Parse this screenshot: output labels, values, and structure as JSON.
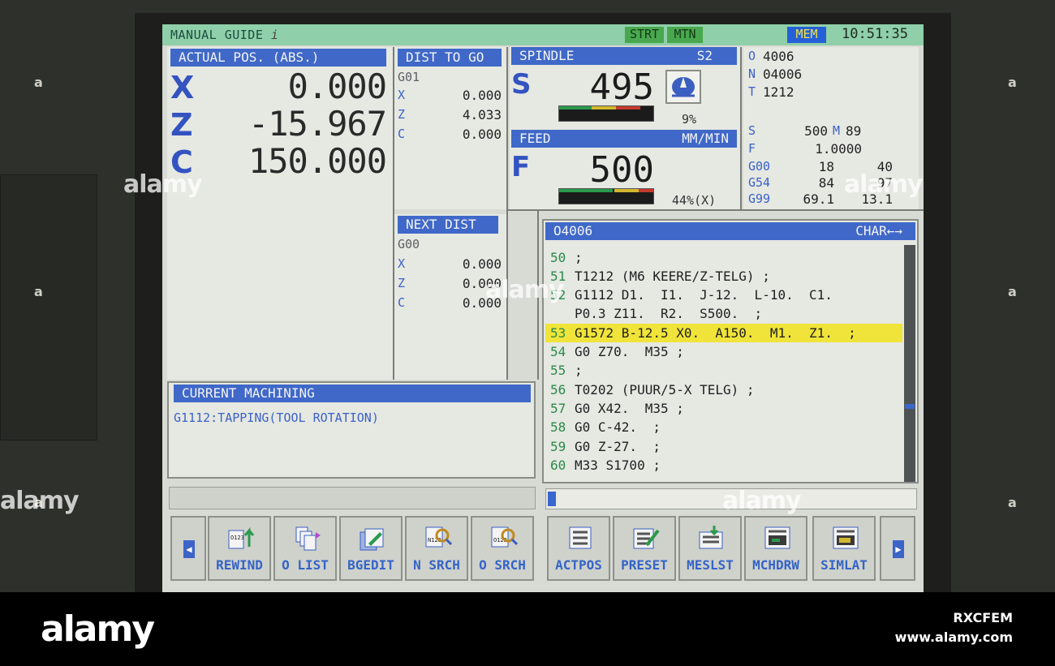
{
  "status": {
    "mode": "MANUAL GUIDE",
    "mode_suffix": "i",
    "strt": "STRT",
    "mtn": "MTN",
    "mem": "MEM",
    "clock": "10:51:35"
  },
  "actual_pos": {
    "title": "ACTUAL POS. (ABS.)",
    "axes": [
      {
        "axis": "X",
        "value": "0.000"
      },
      {
        "axis": "Z",
        "value": "-15.967"
      },
      {
        "axis": "C",
        "value": "150.000"
      }
    ]
  },
  "dist_to_go": {
    "title": "DIST TO GO",
    "gcode": "G01",
    "rows": [
      {
        "axis": "X",
        "value": "0.000"
      },
      {
        "axis": "Z",
        "value": "4.033"
      },
      {
        "axis": "C",
        "value": "0.000"
      }
    ]
  },
  "next_dist": {
    "title": "NEXT DIST",
    "gcode": "G00",
    "rows": [
      {
        "axis": "X",
        "value": "0.000"
      },
      {
        "axis": "Z",
        "value": "0.000"
      },
      {
        "axis": "C",
        "value": "0.000"
      }
    ]
  },
  "spindle": {
    "title": "SPINDLE",
    "id": "S2",
    "letter": "S",
    "value": "495",
    "load": "9%",
    "load_fraction": 0.09
  },
  "feed": {
    "title": "FEED",
    "unit": "MM/MIN",
    "letter": "F",
    "value": "500",
    "override": "44%(X)",
    "override_fraction": 0.44
  },
  "modal": {
    "o_label": "O",
    "o_value": "4006",
    "n_label": "N",
    "n_value": "04006",
    "t_label": "T",
    "t_value": "1212",
    "s_label": "S",
    "s_value": "500",
    "m_label": "M",
    "m_value": "89",
    "f_label": "F",
    "f_value": "1.0000",
    "g00_label": "G00",
    "g00_a": "18",
    "g00_b": "40",
    "g54_label": "G54",
    "g54_a": "84",
    "g54_b": "97",
    "g99_label": "G99",
    "g99_a": "69.1",
    "g99_b": "13.1"
  },
  "program": {
    "title": "O4006",
    "mode": "CHAR←→",
    "lines": [
      {
        "n": "50",
        "text": ";"
      },
      {
        "n": "51",
        "text": "T1212 (M6 KEERE/Z-TELG) ;"
      },
      {
        "n": "52",
        "text": "G1112 D1.  I1.  J-12.  L-10.  C1."
      },
      {
        "n": "",
        "text": "P0.3 Z11.  R2.  S500.  ;"
      },
      {
        "n": "53",
        "text": "G1572 B-12.5 X0.  A150.  M1.  Z1.  ;"
      },
      {
        "n": "54",
        "text": "G0 Z70.  M35 ;"
      },
      {
        "n": "55",
        "text": ";"
      },
      {
        "n": "56",
        "text": "T0202 (PUUR/5-X TELG) ;"
      },
      {
        "n": "57",
        "text": "G0 X42.  M35 ;"
      },
      {
        "n": "58",
        "text": "G0 C-42.  ;"
      },
      {
        "n": "59",
        "text": "G0 Z-27.  ;"
      },
      {
        "n": "60",
        "text": "M33 S1700 ;"
      }
    ]
  },
  "current_machining": {
    "title": "CURRENT MACHINING",
    "text": "G1112:TAPPING(TOOL ROTATION)"
  },
  "softkeys": {
    "rewind": "REWIND",
    "o_list": "O LIST",
    "bgedit": "BGEDIT",
    "n_srch": "N SRCH",
    "o_srch": "O SRCH",
    "actpos": "ACTPOS",
    "preset": "PRESET",
    "meslst": "MESLST",
    "mchdrw": "MCHDRW",
    "simlat": "SIMLAT",
    "icon_text_o123": "O123",
    "icon_text_n123": "N123"
  },
  "footer": {
    "logo": "alamy",
    "watermark": "alamy",
    "image_id": "RXCFEM",
    "url": "www.alamy.com"
  },
  "colors": {
    "header_blue": "#3f68c8",
    "status_green": "#8fcfa9",
    "highlight_yellow": "#f0e43a",
    "axis_blue": "#3353c0"
  }
}
